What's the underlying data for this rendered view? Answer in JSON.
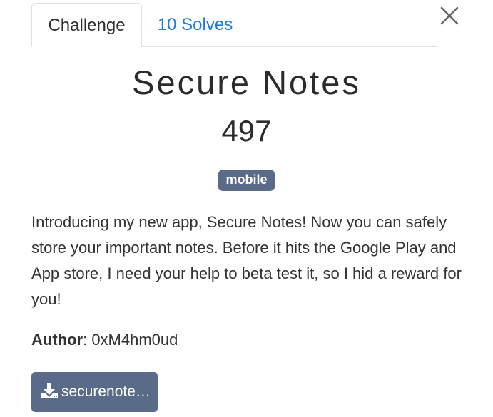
{
  "tabs": [
    {
      "label": "Challenge"
    },
    {
      "label": "10 Solves"
    }
  ],
  "challenge": {
    "name": "Secure Notes",
    "points": "497",
    "category": "mobile",
    "description": "Introducing my new app, Secure Notes! Now you can safely store your important notes. Before it hits the Google Play and App store, I need your help to beta test it, so I hid a reward for you!",
    "author_label": "Author",
    "author_value": ": 0xM4hm0ud",
    "file_label": "securenote…"
  },
  "icons": {
    "close": "close-icon",
    "download": "download-icon"
  },
  "colors": {
    "link": "#1b7be0",
    "badge": "#5a6b8a",
    "button": "#5a6b8a"
  }
}
